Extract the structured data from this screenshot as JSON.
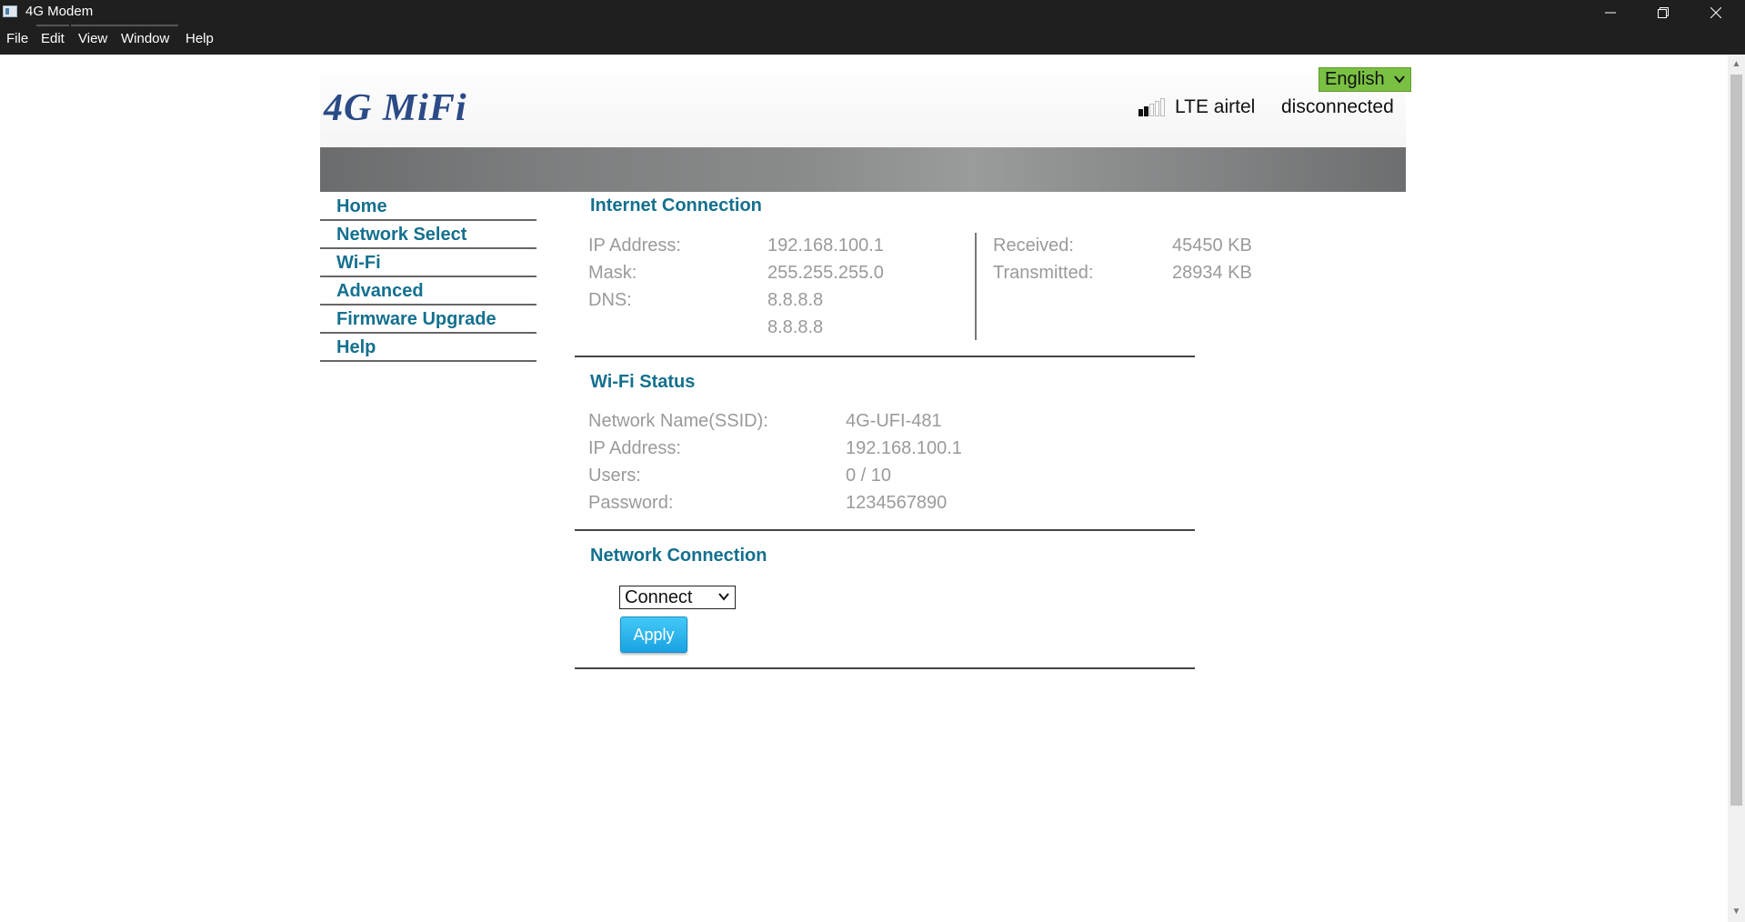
{
  "window": {
    "title": "4G Modem",
    "menu": [
      "File",
      "Edit",
      "View",
      "Window",
      "Help"
    ]
  },
  "header": {
    "logo_text": "4G MiFi",
    "language": "English",
    "network_name": "LTE airtel",
    "connection_status": "disconnected",
    "signal_bars": 2,
    "signal_bars_total": 5
  },
  "nav": {
    "items": [
      "Home",
      "Network Select",
      "Wi-Fi",
      "Advanced",
      "Firmware Upgrade",
      "Help"
    ]
  },
  "internet": {
    "title": "Internet Connection",
    "ip_label": "IP Address:",
    "ip_value": "192.168.100.1",
    "mask_label": "Mask:",
    "mask_value": "255.255.255.0",
    "dns_label": "DNS:",
    "dns_values": [
      "8.8.8.8",
      "8.8.8.8"
    ],
    "received_label": "Received:",
    "received_value": "45450 KB",
    "transmitted_label": "Transmitted:",
    "transmitted_value": "28934 KB"
  },
  "wifi": {
    "title": "Wi-Fi Status",
    "ssid_label": "Network Name(SSID):",
    "ssid_value": "4G-UFI-481",
    "ip_label": "IP Address:",
    "ip_value": "192.168.100.1",
    "users_label": "Users:",
    "users_value": "0 / 10",
    "password_label": "Password:",
    "password_value": "1234567890"
  },
  "network_connection": {
    "title": "Network Connection",
    "selected_option": "Connect",
    "apply_label": "Apply"
  },
  "colors": {
    "accent": "#14708e",
    "language_bg": "#7ac143",
    "apply_bg": "#1aa3e3",
    "titlebar_bg": "#1f1f1f"
  }
}
